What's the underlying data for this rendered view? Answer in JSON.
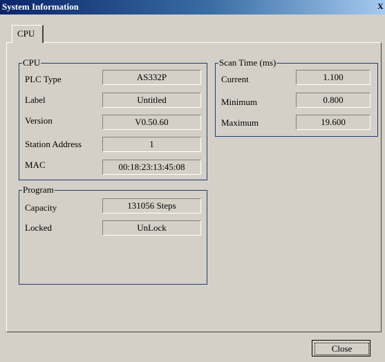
{
  "window": {
    "title": "System Information",
    "close_glyph": "X"
  },
  "tabs": [
    {
      "label": "CPU"
    }
  ],
  "cpu_group": {
    "legend": "CPU",
    "fields": [
      {
        "label": "PLC Type",
        "value": "AS332P"
      },
      {
        "label": "Label",
        "value": "Untitled"
      },
      {
        "label": "Version",
        "value": "V0.50.60"
      },
      {
        "label": "Station Address",
        "value": "1"
      },
      {
        "label": "MAC",
        "value": "00:18:23:13:45:08"
      }
    ]
  },
  "scan_group": {
    "legend": "Scan Time (ms)",
    "fields": [
      {
        "label": "Current",
        "value": "1.100"
      },
      {
        "label": "Minimum",
        "value": "0.800"
      },
      {
        "label": "Maximum",
        "value": "19.600"
      }
    ]
  },
  "program_group": {
    "legend": "Program",
    "fields": [
      {
        "label": "Capacity",
        "value": "131056 Steps"
      },
      {
        "label": "Locked",
        "value": "UnLock"
      }
    ]
  },
  "footer": {
    "close_label": "Close"
  }
}
